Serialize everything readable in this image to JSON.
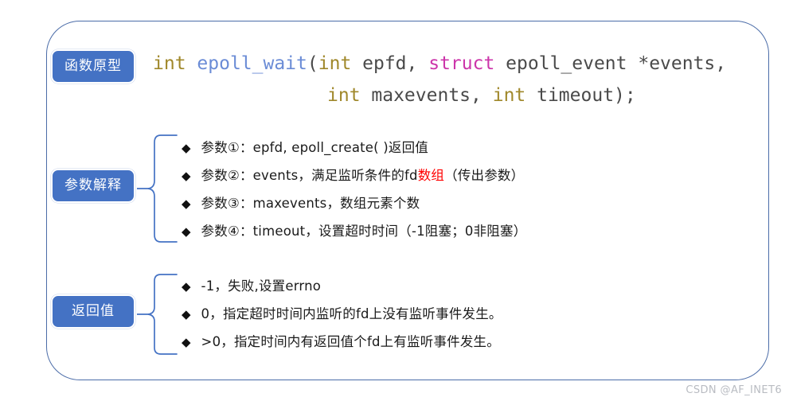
{
  "frame": {
    "border_color": "#4B6CA8"
  },
  "badges": {
    "accent_color": "#4472C4",
    "prototype": "函数原型",
    "parameters": "参数解释",
    "return": "返回值"
  },
  "code": {
    "colors": {
      "keyword_int": "#A0882B",
      "function": "#6B8CD6",
      "keyword_struct": "#CC35AA",
      "plain": "#4d4d4d"
    },
    "line1": {
      "t1": "int",
      "t2": " ",
      "t3": "epoll_wait",
      "t4": "(",
      "t5": "int",
      "t6": " epfd, ",
      "t7": "struct",
      "t8": " epoll_event *events,"
    },
    "line2": {
      "t1": "int",
      "t2": " maxevents, ",
      "t3": "int",
      "t4": " timeout);"
    }
  },
  "parameters": {
    "bullet_glyph": "◆",
    "highlight_color": "#FF0000",
    "items": [
      {
        "pre": "参数①：epfd, epoll_create( )返回值",
        "hl": "",
        "post": ""
      },
      {
        "pre": "参数②：events，满足监听条件的fd",
        "hl": "数组",
        "post": "（传出参数）"
      },
      {
        "pre": "参数③：maxevents，数组元素个数",
        "hl": "",
        "post": ""
      },
      {
        "pre": "参数④：timeout，设置超时时间（-1阻塞；0非阻塞）",
        "hl": "",
        "post": ""
      }
    ]
  },
  "return_values": {
    "bullet_glyph": "◆",
    "items": [
      {
        "pre": "-1，失败,设置errno",
        "hl": "",
        "post": ""
      },
      {
        "pre": "0，指定超时时间内监听的fd上没有监听事件发生。",
        "hl": "",
        "post": ""
      },
      {
        "pre": ">0，指定时间内有返回值个fd上有监听事件发生。",
        "hl": "",
        "post": ""
      }
    ]
  },
  "watermark": {
    "text": "CSDN @AF_INET6"
  }
}
